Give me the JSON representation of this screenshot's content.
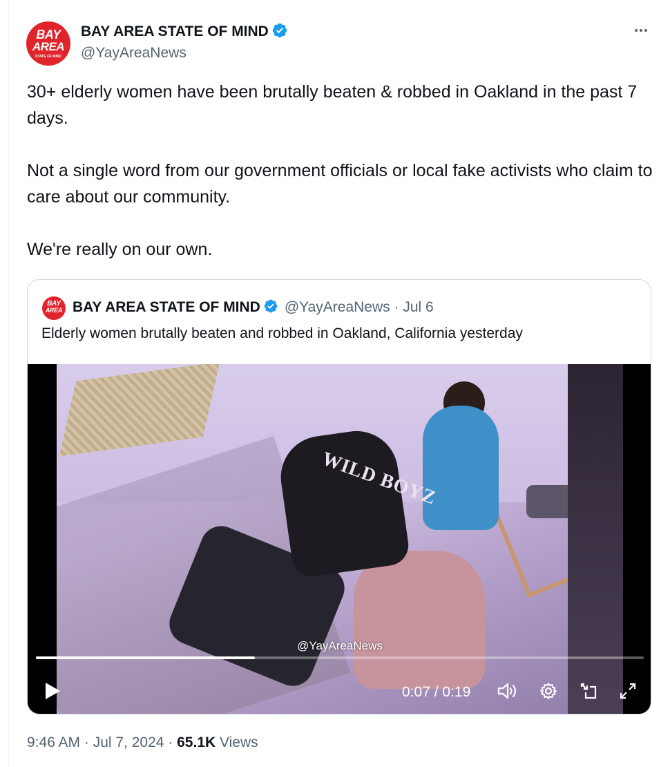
{
  "author": {
    "name": "BAY AREA STATE OF MIND",
    "handle": "@YayAreaNews",
    "avatar": {
      "line1": "BAY",
      "line2": "AREA",
      "line3": "STATE OF MIND",
      "color": "#e0242b"
    },
    "verified_icon": "verified-badge-icon",
    "verified_color": "#1d9bf0"
  },
  "more_icon": "more-dots-icon",
  "tweet": {
    "paragraphs": [
      "30+ elderly women have been brutally beaten & robbed in Oakland in the past 7 days.",
      "Not a single word from our government officials or local fake activists who claim to care about our community.",
      "We're really on our own."
    ]
  },
  "quoted_tweet": {
    "name": "BAY AREA STATE OF MIND",
    "handle_date": "@YayAreaNews · Jul 6",
    "avatar": {
      "line1": "BAY",
      "line2": "AREA"
    },
    "text": "Elderly women brutally beaten and robbed in Oakland, California yesterday",
    "video": {
      "watermark": "@YayAreaNews",
      "jacket_text": "WILD BOYZ",
      "timecode": "0:07 / 0:19",
      "progress": 0.36,
      "icons": [
        "play-icon",
        "volume-icon",
        "settings-gear-icon",
        "picture-in-picture-icon",
        "fullscreen-icon"
      ]
    }
  },
  "meta": {
    "time_date": "9:46 AM · Jul 7, 2024 · ",
    "views_count": "65.1K",
    "views_label": " Views"
  },
  "colors": {
    "text_primary": "#0f1419",
    "text_secondary": "#536471",
    "border": "#cfd9de"
  }
}
